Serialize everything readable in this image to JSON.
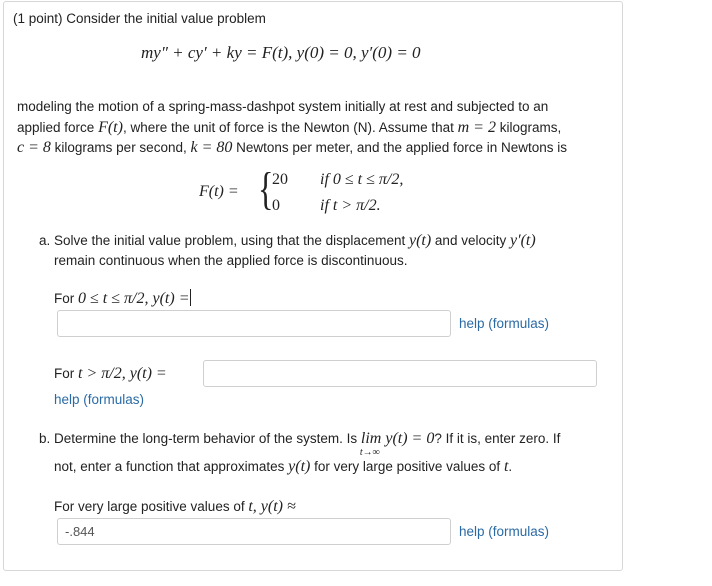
{
  "problem": {
    "intro": "(1 point) Consider the initial value problem",
    "equation": "my″ + cy′ + ky = F(t),   y(0) = 0,   y′(0) = 0",
    "description_line1": "modeling the motion of a spring-mass-dashpot system initially at rest and subjected to an",
    "description_line2_a": "applied force ",
    "description_line2_math": "F(t)",
    "description_line2_b": ", where the unit of force is the Newton (N). Assume that ",
    "description_line2_math2": "m = 2",
    "description_line2_c": " kilograms,",
    "description_line3_math1": "c = 8",
    "description_line3_a": " kilograms per second, ",
    "description_line3_math2": "k = 80",
    "description_line3_b": " Newtons per meter, and the applied force in Newtons is",
    "piecewise": {
      "lhs": "F(t) =",
      "case1_value": "20",
      "case1_cond": "if 0 ≤ t ≤ π/2,",
      "case2_value": "0",
      "case2_cond": "if t > π/2."
    }
  },
  "part_a": {
    "text_line1_a": "a. Solve the initial value problem, using that the displacement ",
    "text_line1_math1": "y(t)",
    "text_line1_b": " and velocity ",
    "text_line1_math2": "y′(t)",
    "text_line2": "remain continuous when the applied force is discontinuous.",
    "q1_prefix": "For ",
    "q1_math": "0 ≤ t ≤ π/2,  y(t) =",
    "q1_value": "",
    "q1_help": "help (formulas)",
    "q2_prefix": "For ",
    "q2_math": "t > π/2,  y(t) =",
    "q2_value": "",
    "q2_help": "help (formulas)"
  },
  "part_b": {
    "text_line1_a": "b. Determine the long-term behavior of the system. Is ",
    "text_line1_math": "lim y(t) = 0",
    "text_limit_sub": "t→∞",
    "text_line1_b": "? If it is, enter zero. If",
    "text_line2_a": "not, enter a function that approximates ",
    "text_line2_math": "y(t)",
    "text_line2_b": " for very large positive values of ",
    "text_line2_math2": "t",
    "text_line2_c": ".",
    "q_prefix": "For very large positive values of ",
    "q_math": "t,  y(t) ≈",
    "q_value": "-.844",
    "q_help": "help (formulas)"
  }
}
